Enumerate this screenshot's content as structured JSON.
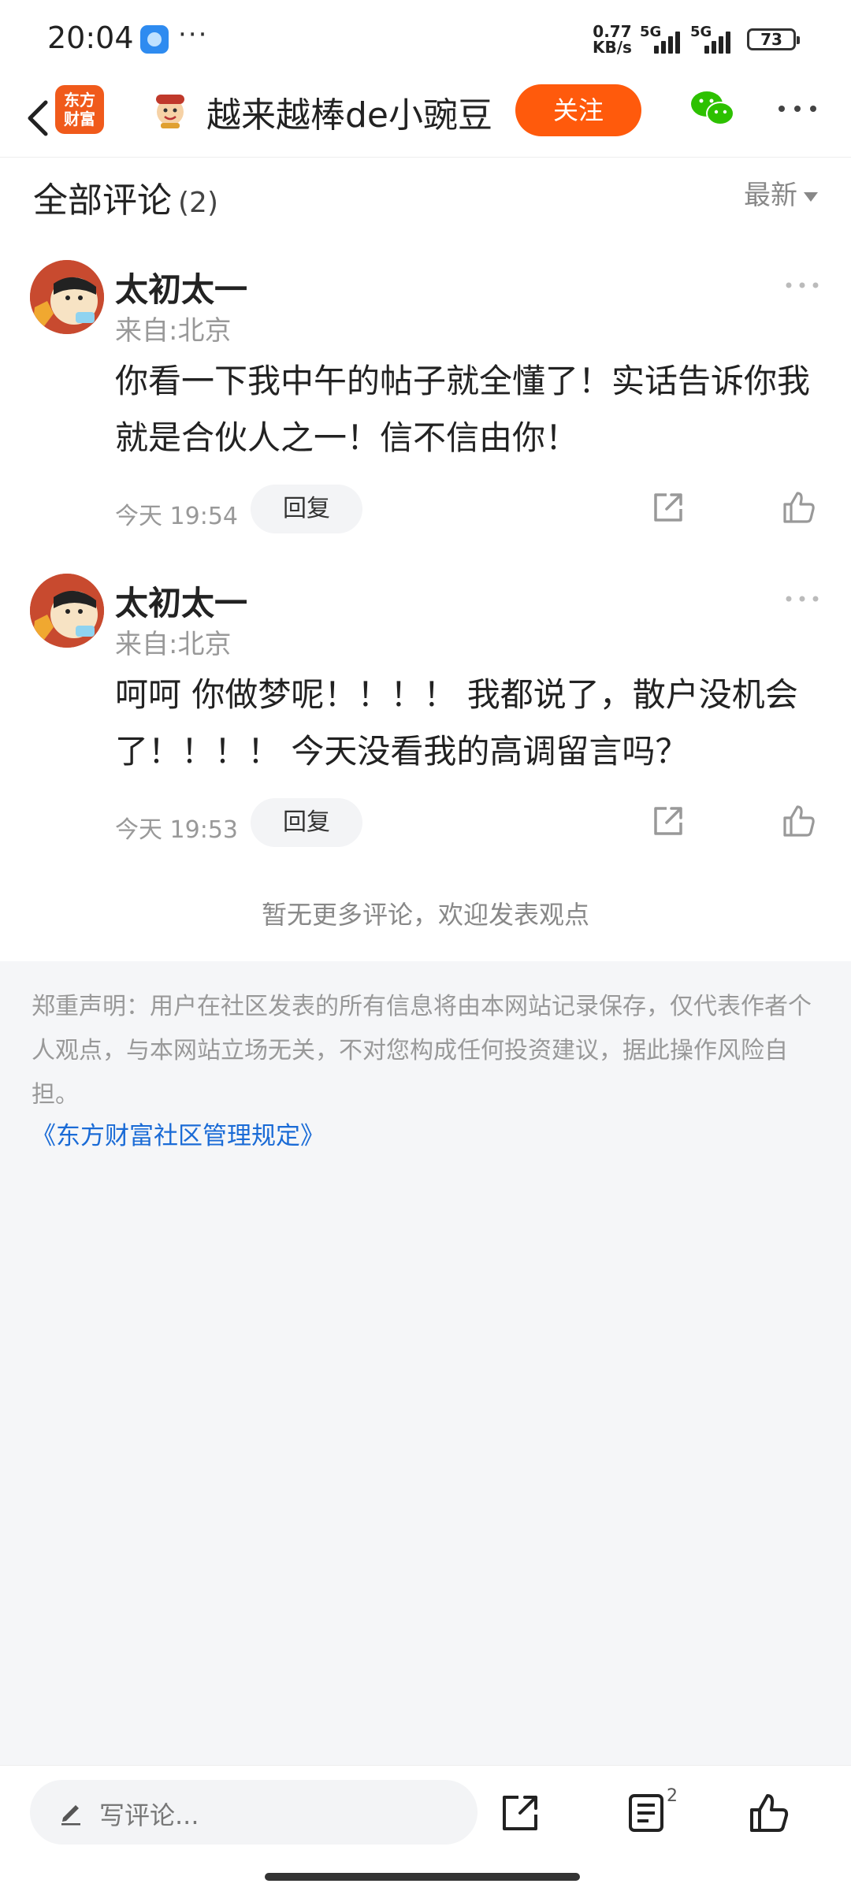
{
  "status_bar": {
    "time": "20:04",
    "dots": "···",
    "speed_value": "0.77",
    "speed_unit": "KB/s",
    "network_1": "5G",
    "network_2": "5G",
    "battery": "73"
  },
  "header": {
    "logo_line1": "东方",
    "logo_line2": "财富",
    "owner_name": "越来越棒de小豌豆",
    "follow_label": "关注"
  },
  "comments_section": {
    "title": "全部评论",
    "count": "(2)",
    "sort_label": "最新",
    "no_more": "暂无更多评论，欢迎发表观点"
  },
  "comments": [
    {
      "author": "太初太一",
      "location": "来自:北京",
      "text": "你看一下我中午的帖子就全懂了！实话告诉你我就是合伙人之一！信不信由你！",
      "time": "今天 19:54",
      "reply_label": "回复"
    },
    {
      "author": "太初太一",
      "location": "来自:北京",
      "text": "呵呵 你做梦呢！！！！ 我都说了，散户没机会了！！！！ 今天没看我的高调留言吗？",
      "time": "今天 19:53",
      "reply_label": "回复"
    }
  ],
  "disclaimer": {
    "text": "郑重声明：用户在社区发表的所有信息将由本网站记录保存，仅代表作者个人观点，与本网站立场无关，不对您构成任何投资建议，据此操作风险自担。",
    "rules_link": "《东方财富社区管理规定》"
  },
  "bottom_bar": {
    "input_placeholder": "写评论...",
    "comment_count": "2"
  },
  "colors": {
    "accent": "#ff5a0c",
    "link": "#1a6bd6",
    "wechat": "#2dc100"
  }
}
